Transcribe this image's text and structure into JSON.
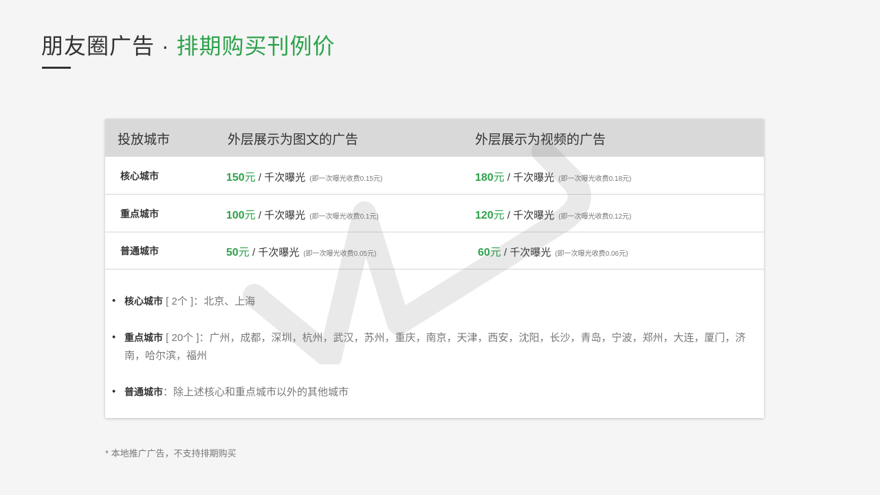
{
  "header": {
    "title_main": "朋友圈广告",
    "title_sep": "·",
    "title_accent": "排期购买刊例价"
  },
  "table": {
    "headers": [
      "投放城市",
      "外层展示为图文的广告",
      "外层展示为视频的广告"
    ],
    "rows": [
      {
        "city": "核心城市",
        "image_price": "150",
        "video_price": "180",
        "image_note": "(即一次曝光收费0.15元)",
        "video_note": "(即一次曝光收费0.18元)"
      },
      {
        "city": "重点城市",
        "image_price": "100",
        "video_price": "120",
        "image_note": "(即一次曝光收费0.1元)",
        "video_note": "(即一次曝光收费0.12元)"
      },
      {
        "city": "普通城市",
        "image_price": "50",
        "video_price": "60",
        "image_note": "(即一次曝光收费0.05元)",
        "video_note": "(即一次曝光收费0.06元)"
      }
    ],
    "unit": "元",
    "per_label": " / 千次曝光"
  },
  "notes": [
    {
      "bullet": "•",
      "label": "核心城市",
      "count": " [ 2个 ]：",
      "text": "北京、上海"
    },
    {
      "bullet": "•",
      "label": "重点城市",
      "count": " [ 20个 ]：",
      "text": "广州，成都，深圳，杭州，武汉，苏州，重庆，南京，天津，西安，沈阳，长沙，青岛，宁波，郑州，大连，厦门，济南，哈尔滨，福州"
    },
    {
      "bullet": "•",
      "label": "普通城市",
      "count": "：",
      "text": "除上述核心和重点城市以外的其他城市"
    }
  ],
  "footnote": "* 本地推广广告，不支持排期购买",
  "colors": {
    "accent": "#2ea24b",
    "header_bg": "#d9d9d9",
    "text": "#333333",
    "muted": "#777777"
  }
}
